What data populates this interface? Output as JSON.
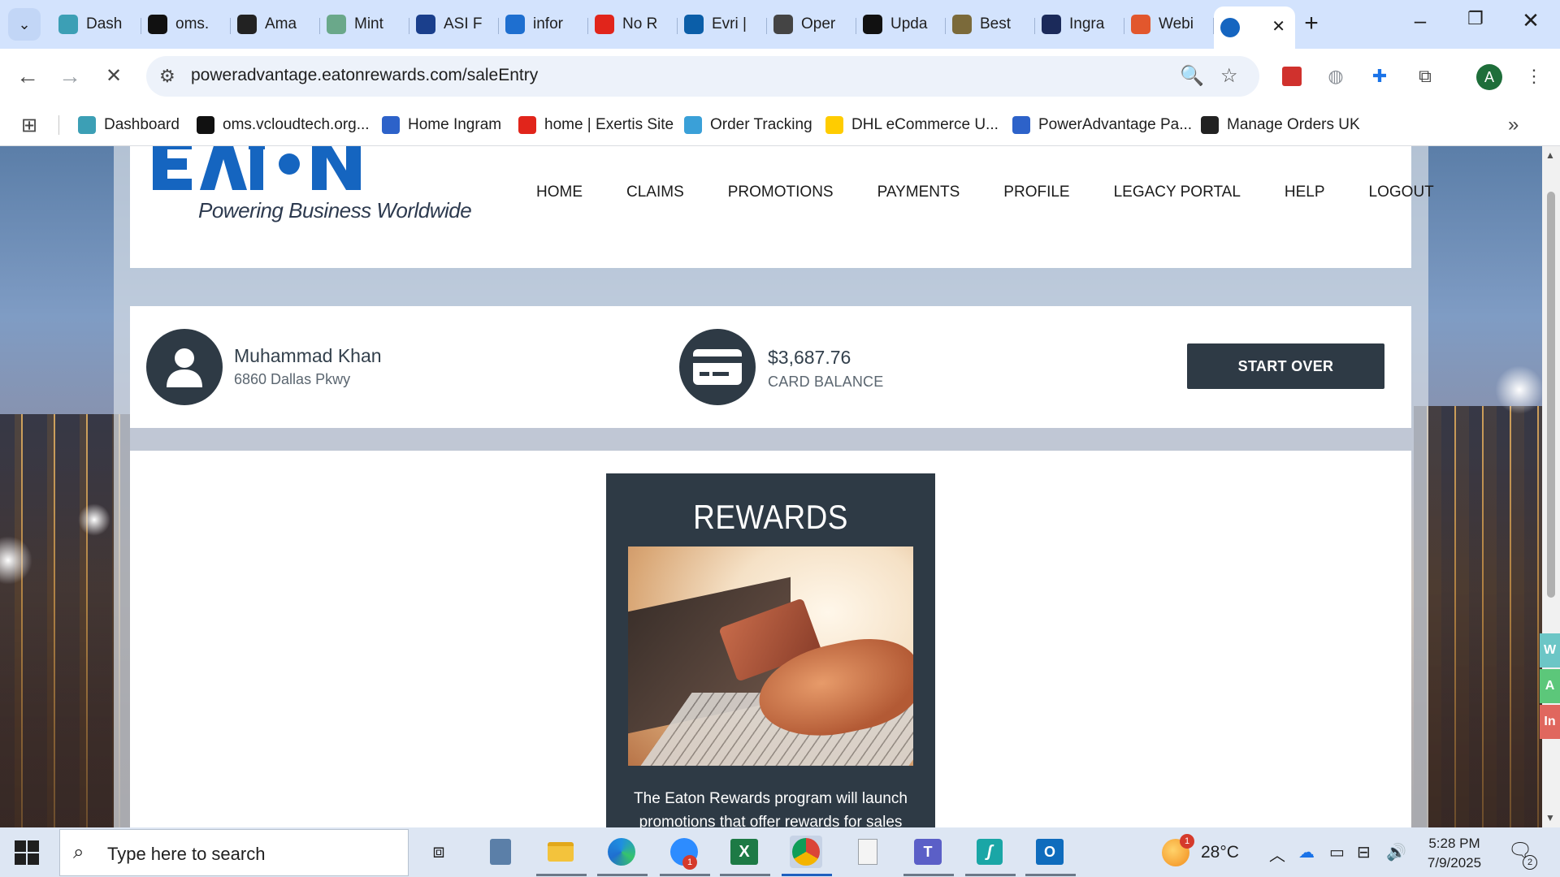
{
  "browser": {
    "tabs": [
      {
        "title": "Dash",
        "icon": "dashboard-icon",
        "color": "#3c9fb5"
      },
      {
        "title": "oms.",
        "icon": "triangle-logo-icon",
        "color": "#111111"
      },
      {
        "title": "Ama",
        "icon": "amazon-icon",
        "color": "#222222"
      },
      {
        "title": "Mint",
        "icon": "mint-icon",
        "color": "#6aa88a"
      },
      {
        "title": "ASI F",
        "icon": "asi-arrow-icon",
        "color": "#1a3f8c"
      },
      {
        "title": "infor",
        "icon": "infor-icon",
        "color": "#1e6fd0"
      },
      {
        "title": "No R",
        "icon": "exertis-icon",
        "color": "#e1251b"
      },
      {
        "title": "Evri |",
        "icon": "evri-icon",
        "color": "#0b5ea8"
      },
      {
        "title": "Oper",
        "icon": "openai-icon",
        "color": "#444444"
      },
      {
        "title": "Upda",
        "icon": "openai-icon",
        "color": "#111111"
      },
      {
        "title": "Best",
        "icon": "bulb-icon",
        "color": "#7b6a3a"
      },
      {
        "title": "Ingra",
        "icon": "ingram-icon",
        "color": "#1b2a5a"
      },
      {
        "title": "Webi",
        "icon": "webinar-icon",
        "color": "#e2572d"
      }
    ],
    "active_tab": {
      "title": "",
      "icon": "eaton-icon"
    },
    "address": "poweradvantage.eatonrewards.com/saleEntry",
    "bookmarks": [
      {
        "label": "Dashboard",
        "icon": "dashboard-icon",
        "color": "#3c9fb5"
      },
      {
        "label": "oms.vcloudtech.org...",
        "icon": "triangle-logo-icon",
        "color": "#111111"
      },
      {
        "label": "Home Ingram",
        "icon": "ingram-im-icon",
        "color": "#2d62c9"
      },
      {
        "label": "home | Exertis Site",
        "icon": "exertis-icon",
        "color": "#e1251b"
      },
      {
        "label": "Order Tracking",
        "icon": "tracking-icon",
        "color": "#3aa0d8"
      },
      {
        "label": "DHL eCommerce U...",
        "icon": "dhl-icon",
        "color": "#ffcc00"
      },
      {
        "label": "PowerAdvantage Pa...",
        "icon": "document-icon",
        "color": "#2d62c9"
      },
      {
        "label": "Manage Orders UK",
        "icon": "amazon-icon",
        "color": "#222222"
      }
    ],
    "avatar_letter": "A"
  },
  "site": {
    "logo_text": "EATON",
    "tagline": "Powering Business Worldwide",
    "nav": [
      "HOME",
      "CLAIMS",
      "PROMOTIONS",
      "PAYMENTS",
      "PROFILE",
      "LEGACY PORTAL",
      "HELP",
      "LOGOUT"
    ]
  },
  "user": {
    "name": "Muhammad Khan",
    "address": "6860 Dallas Pkwy",
    "balance": "$3,687.76",
    "balance_label": "CARD BALANCE",
    "start_over": "START OVER"
  },
  "rewards": {
    "title": "REWARDS",
    "description": "The Eaton Rewards program will launch promotions that offer rewards for sales"
  },
  "side_tabs": [
    {
      "letter": "W",
      "color": "#6cc6c6"
    },
    {
      "letter": "A",
      "color": "#5cc77a"
    },
    {
      "letter": "In",
      "color": "#e0675e"
    }
  ],
  "taskbar": {
    "search_placeholder": "Type here to search",
    "weather_temp": "28°C",
    "time": "5:28 PM",
    "date": "7/9/2025",
    "zoom_badge": "1",
    "weather_badge": "1",
    "notification_count": "2"
  },
  "colors": {
    "eaton_blue": "#1565c0",
    "panel_dark": "#2e3a45"
  }
}
